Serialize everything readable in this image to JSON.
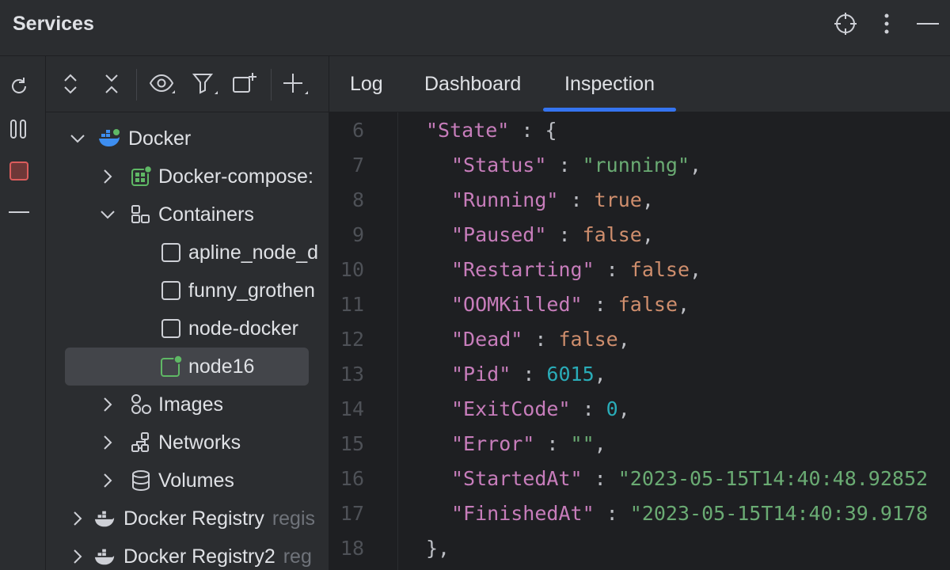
{
  "window": {
    "title": "Services"
  },
  "tree_toolbar": {},
  "tree": [
    {
      "label": "Docker",
      "level": 0,
      "expanded": true,
      "icon": "docker-icon"
    },
    {
      "label": "Docker-compose:",
      "level": 1,
      "expanded": false,
      "icon": "compose-icon"
    },
    {
      "label": "Containers",
      "level": 1,
      "expanded": true,
      "icon": "containers-icon"
    },
    {
      "label": "apline_node_d",
      "level": 2,
      "icon": "container-icon"
    },
    {
      "label": "funny_grothen",
      "level": 2,
      "icon": "container-icon"
    },
    {
      "label": "node-docker",
      "level": 2,
      "icon": "container-icon"
    },
    {
      "label": "node16",
      "level": 2,
      "icon": "container-running-icon",
      "selected": true
    },
    {
      "label": "Images",
      "level": 1,
      "expanded": false,
      "icon": "images-icon"
    },
    {
      "label": "Networks",
      "level": 1,
      "expanded": false,
      "icon": "networks-icon"
    },
    {
      "label": "Volumes",
      "level": 1,
      "expanded": false,
      "icon": "volumes-icon"
    },
    {
      "label": "Docker Registry",
      "hint": "regis",
      "level": 0,
      "expanded": false,
      "icon": "registry-icon"
    },
    {
      "label": "Docker Registry2",
      "hint": "reg",
      "level": 0,
      "expanded": false,
      "icon": "registry-icon"
    }
  ],
  "tabs": [
    {
      "label": "Log",
      "active": false
    },
    {
      "label": "Dashboard",
      "active": false
    },
    {
      "label": "Inspection",
      "active": true
    }
  ],
  "editor": {
    "lines": [
      {
        "num": "6",
        "key": "\"State\"",
        "value": "{",
        "type": "punc",
        "indent": 0,
        "comma": ""
      },
      {
        "num": "7",
        "key": "\"Status\"",
        "value": "\"running\"",
        "type": "str",
        "indent": 1,
        "comma": ","
      },
      {
        "num": "8",
        "key": "\"Running\"",
        "value": "true",
        "type": "kw",
        "indent": 1,
        "comma": ","
      },
      {
        "num": "9",
        "key": "\"Paused\"",
        "value": "false",
        "type": "kw",
        "indent": 1,
        "comma": ","
      },
      {
        "num": "10",
        "key": "\"Restarting\"",
        "value": "false",
        "type": "kw",
        "indent": 1,
        "comma": ","
      },
      {
        "num": "11",
        "key": "\"OOMKilled\"",
        "value": "false",
        "type": "kw",
        "indent": 1,
        "comma": ","
      },
      {
        "num": "12",
        "key": "\"Dead\"",
        "value": "false",
        "type": "kw",
        "indent": 1,
        "comma": ","
      },
      {
        "num": "13",
        "key": "\"Pid\"",
        "value": "6015",
        "type": "num",
        "indent": 1,
        "comma": ","
      },
      {
        "num": "14",
        "key": "\"ExitCode\"",
        "value": "0",
        "type": "num",
        "indent": 1,
        "comma": ","
      },
      {
        "num": "15",
        "key": "\"Error\"",
        "value": "\"\"",
        "type": "str",
        "indent": 1,
        "comma": ","
      },
      {
        "num": "16",
        "key": "\"StartedAt\"",
        "value": "\"2023-05-15T14:40:48.92852",
        "type": "str",
        "indent": 1,
        "comma": ""
      },
      {
        "num": "17",
        "key": "\"FinishedAt\"",
        "value": "\"2023-05-15T14:40:39.9178",
        "type": "str",
        "indent": 1,
        "comma": ""
      },
      {
        "num": "18",
        "key": "",
        "value": "},",
        "type": "punc",
        "indent": 0,
        "comma": ""
      }
    ]
  },
  "colors": {
    "accent": "#3574f0",
    "stop_red": "#db5c5c",
    "running_green": "#5fb865",
    "docker_blue": "#3d8ef0"
  }
}
